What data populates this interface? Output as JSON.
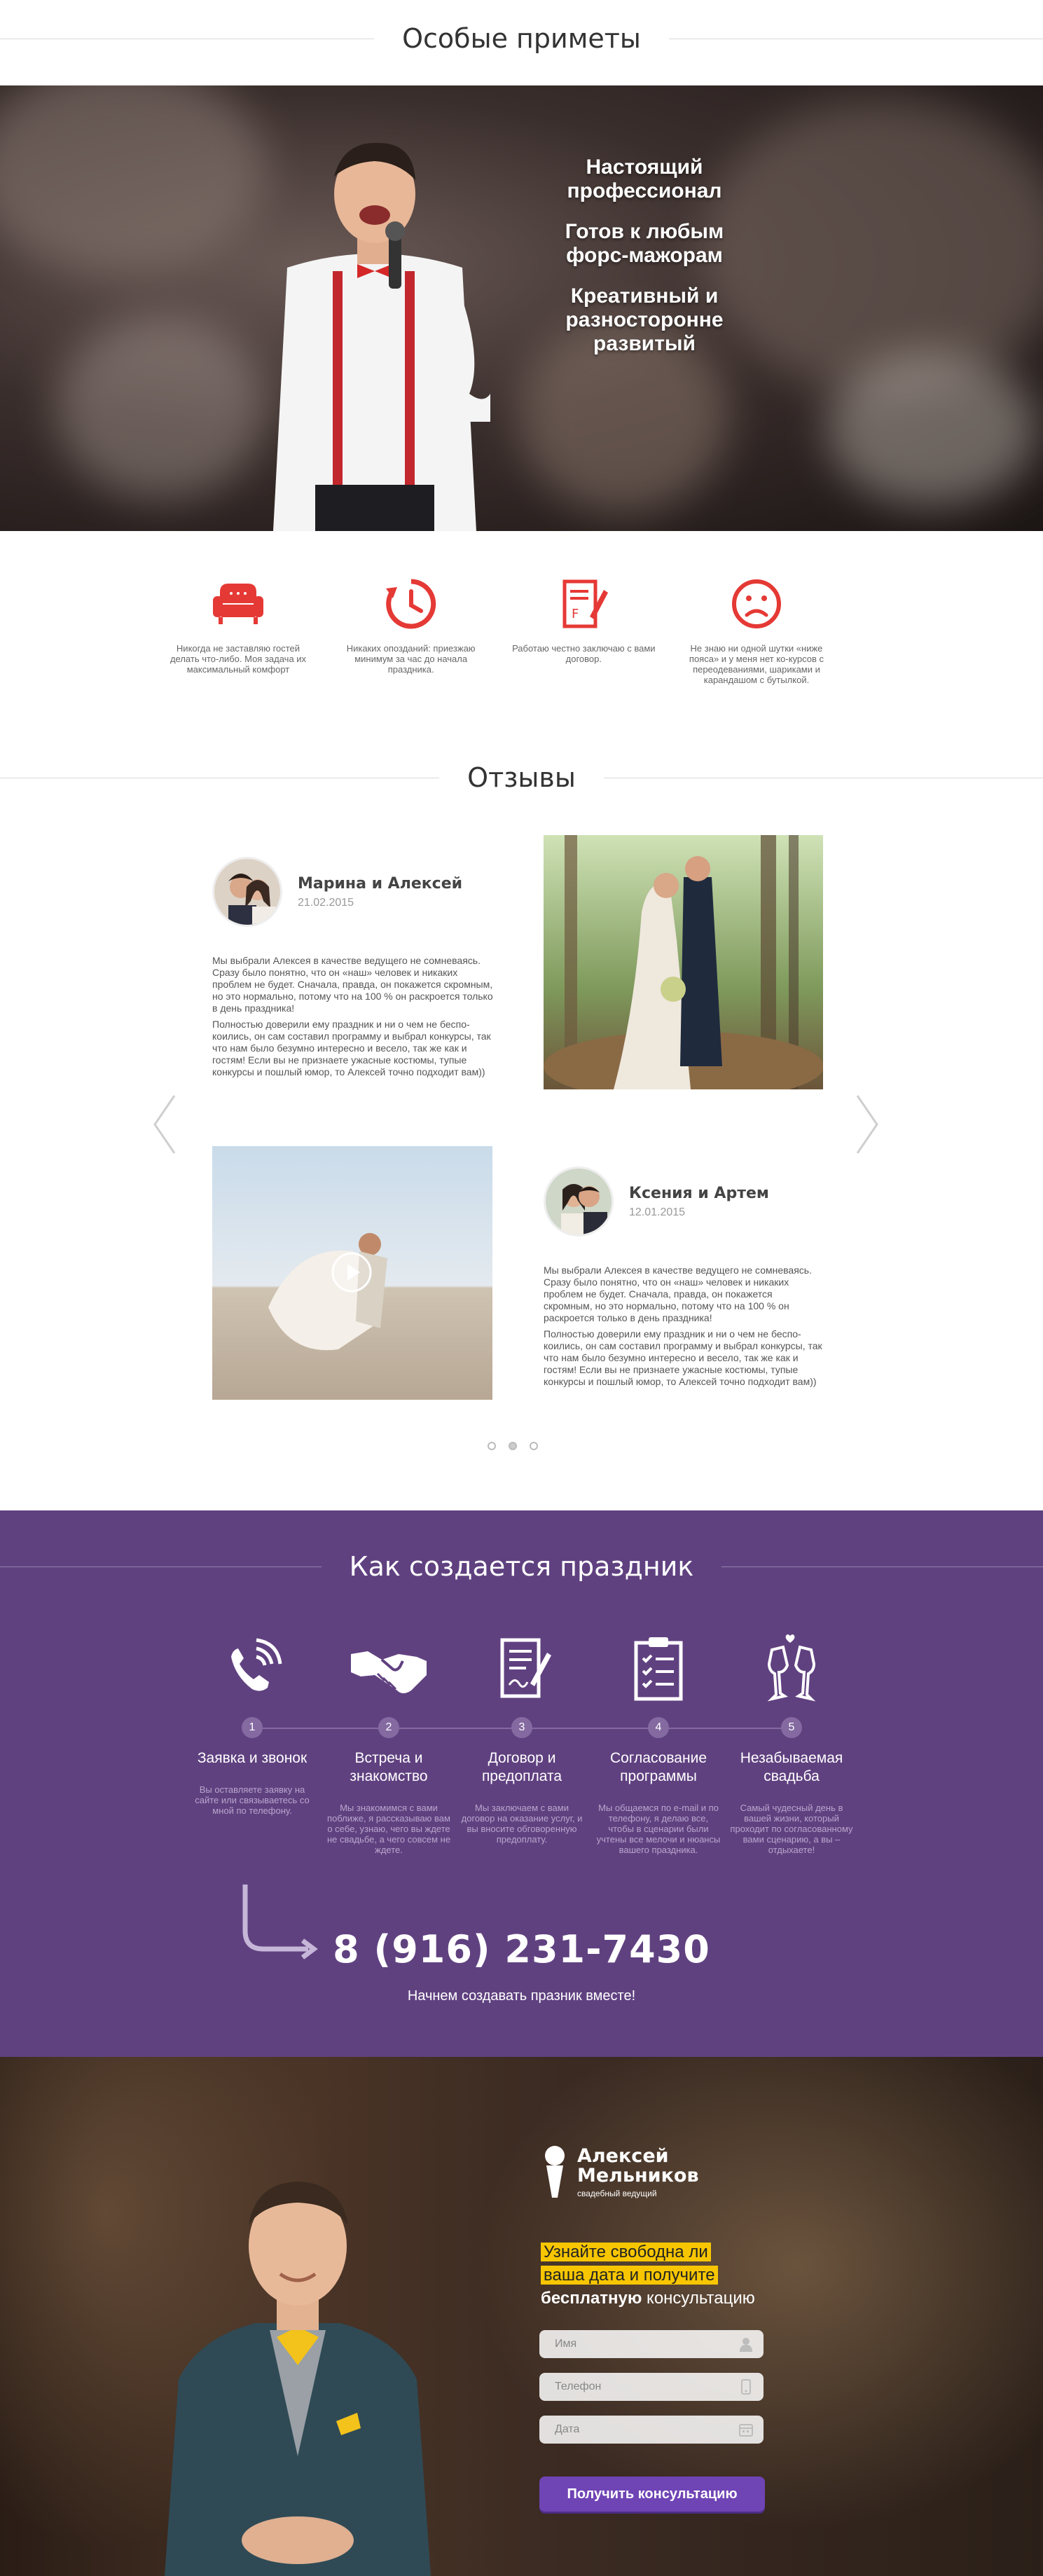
{
  "signs": {
    "title": "Особые приметы",
    "hero_claims": [
      "Настоящий профессионал",
      "Готов к любым форс-мажорам",
      "Креативный и разносторонне развитый"
    ],
    "features": [
      {
        "icon": "armchair-icon",
        "text": "Никогда не заставляю гостей делать что-либо. Моя задача их максимальный комфорт"
      },
      {
        "icon": "clock-icon",
        "text": "Никаких опозданий: приезжаю минимум за час до начала праздника."
      },
      {
        "icon": "contract-icon",
        "text": "Работаю честно заключаю с вами договор."
      },
      {
        "icon": "sad-face-icon",
        "text": "Не знаю ни одной шутки «ниже пояса» и у меня нет ко-курсов с переодеваниями, шариками и карандашом с бутылкой."
      }
    ],
    "accent_color": "#e53935"
  },
  "reviews": {
    "title": "Отзывы",
    "items": [
      {
        "name": "Марина и Алексей",
        "date": "21.02.2015",
        "p1": "Мы выбрали Алексея в качестве ведущего не сомне­ваясь. Сразу было понятно, что он «наш» человек и ника­ких проблем не будет. Сначала, правда, он покажется скромным, но это нормально, потому что на 100 % он раскроется только в день праздника!",
        "p2": "Полностью доверили ему праздник и ни о чем не беспо­коились, он сам составил программу и выбрал конкурсы, так что нам было безумно интересно и весело, так же как и гостям! Если вы не признаете ужасные костюмы, тупые конкурсы и пошлый юмор, то Алексей точно под­ходит вам))"
      },
      {
        "name": "Ксения и Артем",
        "date": "12.01.2015",
        "p1": "Мы выбрали Алексея в качестве ведущего не сомнева­ясь. Сразу было понятно, что он «наш» человек и ника­ких проблем не будет. Сначала, правда, он покажется скромным, но это нормально, потому что на 100 % он раскроется только в день праздника!",
        "p2": "Полностью доверили ему праздник и ни о чем не беспо­коились, он сам составил программу и выбрал конкурсы, так что нам было безумно интересно и весело, так же как и гостям! Если вы не признаете ужасные костюмы, тупые конкурсы и пошлый юмор, то Алексей точно под­ходит вам))"
      }
    ],
    "pagination": [
      1,
      2,
      3
    ],
    "active_page": 1
  },
  "process": {
    "title": "Как создается праздник",
    "steps": [
      {
        "num": "1",
        "title": "Заявка и звонок",
        "icon": "phone-call-icon",
        "text": "Вы оставляете заявку на сайте или связываетесь со мной по телефону."
      },
      {
        "num": "2",
        "title": "Встреча и знакомство",
        "icon": "handshake-icon",
        "text": "Мы знакомимся с вами поближе, я рассказываю вам о себе, узнаю, чего вы ждете не свадьбе, а чего совсем не ждете."
      },
      {
        "num": "3",
        "title": "Договор и предоплата",
        "icon": "contract-sign-icon",
        "text": "Мы заключаем с вами договор на оказание услуг, и вы вносите обговоренную предоплату."
      },
      {
        "num": "4",
        "title": "Согласование программы",
        "icon": "checklist-icon",
        "text": "Мы общаемся по e-mail и по телефону, я делаю все, чтобы в сценарии были учтены все мелочи и нюансы вашего праздника."
      },
      {
        "num": "5",
        "title": "Незабываемая свадьба",
        "icon": "champagne-glasses-icon",
        "text": "Самый чудесный день в вашей жизни, который проходит по согласованному вами сценарию, а вы – отдыхаете!"
      }
    ],
    "phone": "8 (916) 231-7430",
    "phone_sub": "Начнем создавать празник вместе!",
    "bg_color": "#604180"
  },
  "contact": {
    "logo_name_1": "Алексей",
    "logo_name_2": "Мельников",
    "logo_sub": "свадебный ведущий",
    "offer_line1": "Узнайте свободна ли",
    "offer_line2": "ваша дата и получите",
    "offer_bold": "бесплатную",
    "offer_rest": " консультацию",
    "fields": [
      {
        "placeholder": "Имя",
        "icon": "user-icon"
      },
      {
        "placeholder": "Телефон",
        "icon": "phone-icon"
      },
      {
        "placeholder": "Дата",
        "icon": "calendar-icon"
      }
    ],
    "submit": "Получить консультацию",
    "highlight_color": "#f7c600",
    "button_color": "#6f44b5"
  }
}
